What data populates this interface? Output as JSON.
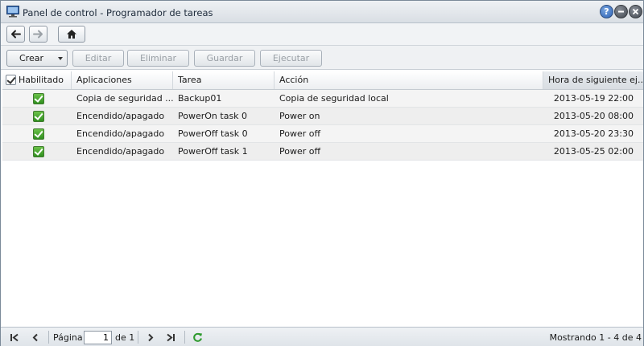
{
  "window": {
    "title": "Panel de control - Programador de tareas",
    "help_icon": "help-icon",
    "minimize_icon": "minimize-icon",
    "close_icon": "close-icon"
  },
  "nav": {
    "back_icon": "arrow-left-icon",
    "forward_icon": "arrow-right-icon",
    "home_icon": "home-icon"
  },
  "toolbar": {
    "crear": "Crear",
    "editar": "Editar",
    "eliminar": "Eliminar",
    "guardar": "Guardar",
    "ejecutar": "Ejecutar"
  },
  "table": {
    "headers": {
      "habilitado": "Habilitado",
      "aplicaciones": "Aplicaciones",
      "tarea": "Tarea",
      "accion": "Acción",
      "hora": "Hora de siguiente ej..."
    },
    "rows": [
      {
        "enabled": true,
        "app": "Copia de seguridad ...",
        "tarea": "Backup01",
        "accion": "Copia de seguridad local",
        "hora": "2013-05-19 22:00"
      },
      {
        "enabled": true,
        "app": "Encendido/apagado",
        "tarea": "PowerOn task 0",
        "accion": "Power on",
        "hora": "2013-05-20 08:00"
      },
      {
        "enabled": true,
        "app": "Encendido/apagado",
        "tarea": "PowerOff task 0",
        "accion": "Power off",
        "hora": "2013-05-20 23:30"
      },
      {
        "enabled": true,
        "app": "Encendido/apagado",
        "tarea": "PowerOff task 1",
        "accion": "Power off",
        "hora": "2013-05-25 02:00"
      }
    ]
  },
  "pager": {
    "page_label": "Página",
    "page_value": "1",
    "page_of": "de 1",
    "showing": "Mostrando 1 - 4 de 4"
  },
  "colors": {
    "accent_green": "#2f8f1e",
    "refresh_green": "#2e9a2e",
    "help_blue": "#2a5fb3"
  }
}
